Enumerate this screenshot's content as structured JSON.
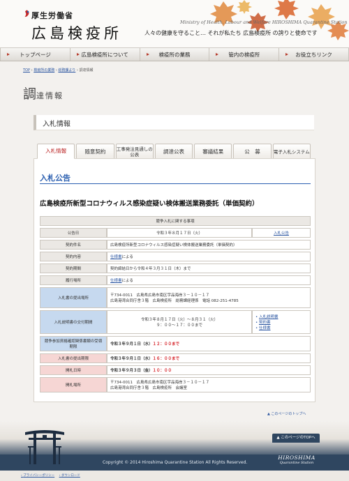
{
  "header": {
    "ministry": "厚生労働省",
    "site_title": "広島検疫所",
    "english": "Ministry of Health, Labour and Welfare   HIROSHIMA Quarantine Station",
    "tagline": "人々の健康を守ること… それが私たち 広島検疫所 の誇りと使命です"
  },
  "nav": {
    "items": [
      "トップページ",
      "広島検疫所について",
      "検疫所の業務",
      "管内の検疫所",
      "お役立ちリンク"
    ]
  },
  "breadcrumb": {
    "items": [
      "TOP",
      "検疫所の業務",
      "総務課より"
    ],
    "separator": " › ",
    "current": "調達情報"
  },
  "page_heading": {
    "first_char": "調",
    "rest": "達情報"
  },
  "section": {
    "title": "入札情報"
  },
  "tabs": [
    {
      "label": "入札情報",
      "active": true
    },
    {
      "label": "随意契約"
    },
    {
      "label": "工事発注見通しの公表"
    },
    {
      "label": "調達公表"
    },
    {
      "label": "審議結果"
    },
    {
      "label": "公　募"
    },
    {
      "label": "電子入札システム"
    }
  ],
  "announcement": {
    "heading": "入札公告",
    "item_title": "広島検疫所新型コロナウィルス感染症疑い検体搬送業務委託（単価契約）",
    "table_header": "競争入札に関する事項",
    "rows": {
      "notice_date": {
        "label": "公告日",
        "value": "令和３年８月１７日（火）",
        "link": "入札公告"
      },
      "contract_name": {
        "label": "契約件名",
        "value": "広島検疫所新型コロナウィルス感染症疑い検体搬送業務委託（単価契約）"
      },
      "contract_details": {
        "label": "契約内容",
        "link": "仕様書",
        "value": "による"
      },
      "contract_period": {
        "label": "契約期間",
        "value": "契約締結日から令和４年３月３１日（木）まで"
      },
      "delivery_place": {
        "label": "履行場所",
        "link": "仕様書",
        "value": "による"
      },
      "submit_place": {
        "label": "入札書の提出場所",
        "line1": "〒734-0011　広島県広島市南区宇品海岸３－１０－１７",
        "line2": "広島港湾合同庁舎３階　広島検疫所　総務課経理係　電話 082-251-4785"
      },
      "doc_period": {
        "label": "入札説明書の交付期間",
        "line1": "令和３年８月１７日（火）～８月３１（火）",
        "line2": "９：００～１７：００まで",
        "links": [
          "入札説明書",
          "契約書",
          "仕様書"
        ]
      },
      "qualification": {
        "label": "競争参加資格確認関係書類の受領期限",
        "date": "令和３年９月１日（水）",
        "time": "１２：００まで"
      },
      "bid_deadline": {
        "label": "入札書の提出期限",
        "date": "令和３年９月１日（水）",
        "time": "１６：００まで"
      },
      "opening_date": {
        "label": "開札日時",
        "date": "令和３年９月３日（金）",
        "time": "１０：００"
      },
      "opening_place": {
        "label": "開札場所",
        "line1": "〒734-0011　広島県広島市南区宇品海岸３－１０－１７",
        "line2": "広島港湾合同庁舎３階　広島検疫所　会議室"
      }
    }
  },
  "back_to_top": "▲ このページのトップへ",
  "footer": {
    "page_top": "▲ このページのTOPへ",
    "copyright": "Copyright © 2014 Hiroshima Quarantine Station All Rights Reserved.",
    "logo_line1": "HIROSHIMA",
    "logo_line2": "Quarantine Station",
    "links": [
      "プライバシーポリシー",
      "ダウンロード"
    ]
  },
  "colors": {
    "accent_red": "#b81c1c",
    "link_blue": "#2a55a0",
    "heading_blue": "#2b5fb0",
    "label_blue": "#c6d9ef",
    "label_pink": "#f6d6d4",
    "footer_navy": "#2f4660"
  }
}
